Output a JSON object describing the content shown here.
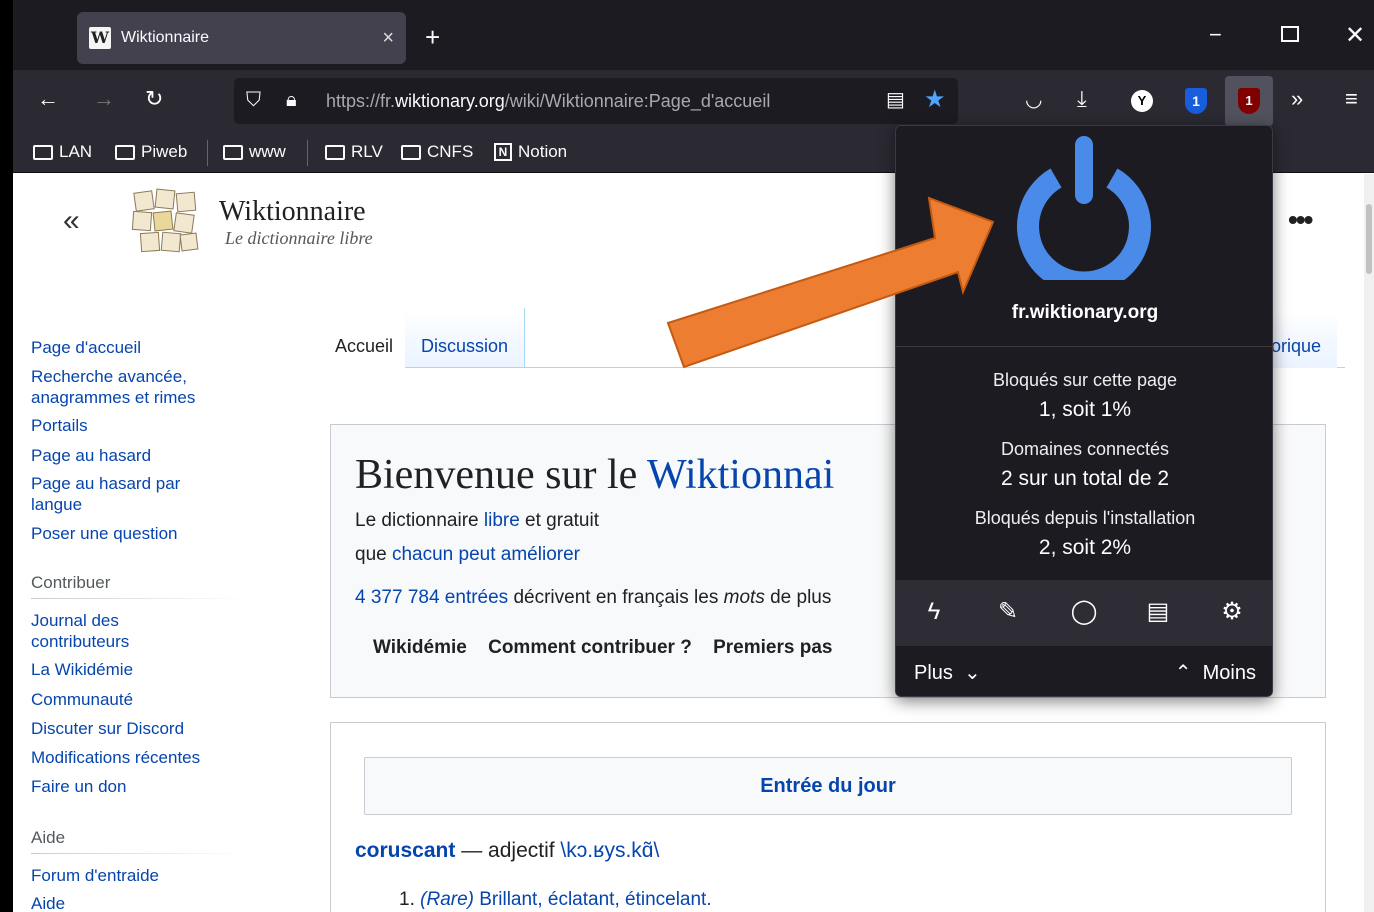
{
  "browser": {
    "tab_title": "Wiktionnaire",
    "tab_favicon": "W",
    "url_prefix": "https://fr.",
    "url_domain": "wiktionary.org",
    "url_path": "/wiki/Wiktionnaire:Page_d'accueil",
    "ublock_badge": "1",
    "bitwarden_badge": "1",
    "bookmarks": [
      "LAN",
      "Piweb",
      "www",
      "RLV",
      "CNFS",
      "Notion"
    ]
  },
  "page": {
    "site_name": "Wiktionnaire",
    "tagline": "Le dictionnaire libre",
    "sidebar": {
      "nav": [
        "Page d'accueil",
        "Recherche avancée,",
        "anagrammes et rimes",
        "Portails",
        "Page au hasard",
        "Page au hasard par",
        "langue",
        "Poser une question"
      ],
      "contribute_head": "Contribuer",
      "contribute": [
        "Journal des",
        "contributeurs",
        "La Wikidémie",
        "Communauté",
        "Discuter sur Discord",
        "Modifications récentes",
        "Faire un don"
      ],
      "help_head": "Aide",
      "help": [
        "Forum d'entraide",
        "Aide"
      ]
    },
    "tabs": {
      "home": "Accueil",
      "discussion": "Discussion",
      "history": "orique"
    },
    "welcome": {
      "title_a": "Bienvenue sur le ",
      "title_b": "Wiktionnai",
      "line1_a": "Le dictionnaire ",
      "line1_b": "libre",
      "line1_c": " et gratuit",
      "line2_a": "que ",
      "line2_b": "chacun peut améliorer",
      "line3_a": "4 377 784 entrées",
      "line3_b": " décrivent en français les ",
      "line3_c": "mots",
      "line3_d": " de plus",
      "links": [
        "Wikidémie",
        "Comment contribuer ?",
        "Premiers pas"
      ]
    },
    "entry": {
      "heading": "Entrée du jour",
      "word": "coruscant",
      "dash": " — adjectif ",
      "pron": "\\kɔ.ʁys.kɑ̃\\",
      "def_num": "1.",
      "def_tag": "(Rare)",
      "def_text": " Brillant, éclatant, étincelant."
    }
  },
  "ublock": {
    "domain": "fr.wiktionary.org",
    "blocked_page_label": "Bloqués sur cette page",
    "blocked_page_value": "1, soit 1%",
    "domains_label": "Domaines connectés",
    "domains_value": "2 sur un total de 2",
    "blocked_total_label": "Bloqués depuis l'installation",
    "blocked_total_value": "2, soit 2%",
    "more": "Plus",
    "less": "Moins",
    "power_color": "#4a8ae8"
  },
  "annotation": {
    "arrow_color": "#ed7d31"
  }
}
